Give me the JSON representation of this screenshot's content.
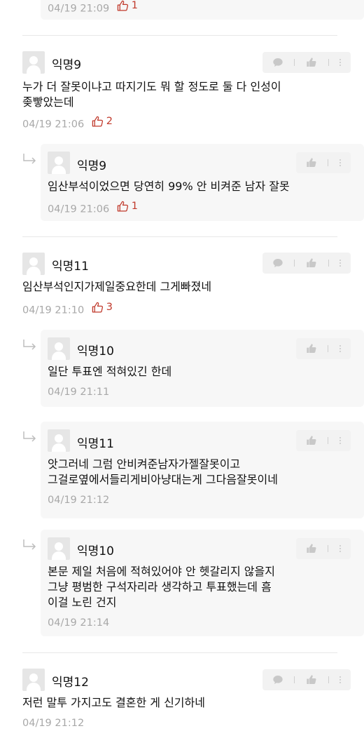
{
  "icons": {
    "reply_arrow": "reply-arrow-icon",
    "vote": "thumbs-up-outline-icon",
    "comment": "speech-bubble-icon",
    "like": "thumbs-up-icon",
    "more": "vertical-dots-icon"
  },
  "colors": {
    "vote": "#c0392b",
    "meta": "#a8a8a8"
  },
  "top_reply": {
    "time": "04/19 21:09",
    "votes": "1"
  },
  "comments": [
    {
      "name": "익명9",
      "text": "누가 더 잘못이냐고 따지기도 뭐 할 정도로 둘 다 인성이\n좆빻았는데",
      "time": "04/19 21:06",
      "votes": "2",
      "replies": [
        {
          "name": "익명9",
          "text": "임산부석이었으면 당연히 99% 안 비켜준 남자 잘못",
          "time": "04/19 21:06",
          "votes": "1"
        }
      ]
    },
    {
      "name": "익명11",
      "text": "임산부석인지가제일중요한데 그게빠졌네",
      "time": "04/19 21:10",
      "votes": "3",
      "replies": [
        {
          "name": "익명10",
          "text": "일단 투표엔 적혀있긴 한데",
          "time": "04/19 21:11"
        },
        {
          "name": "익명11",
          "text": "앗그러네 그럼 안비켜준남자가젤잘못이고\n그걸로옆에서들리게비아냥대는게 그다음잘못이네",
          "time": "04/19 21:12"
        },
        {
          "name": "익명10",
          "text": "본문 제일 처음에 적혀있어야 안 헷갈리지 않을지\n그냥 평범한 구석자리라 생각하고 투표했는데 흠\n이걸 노린 건지",
          "time": "04/19 21:14"
        }
      ]
    },
    {
      "name": "익명12",
      "text": "저런 말투 가지고도 결혼한 게 신기하네",
      "time": "04/19 21:12"
    }
  ]
}
